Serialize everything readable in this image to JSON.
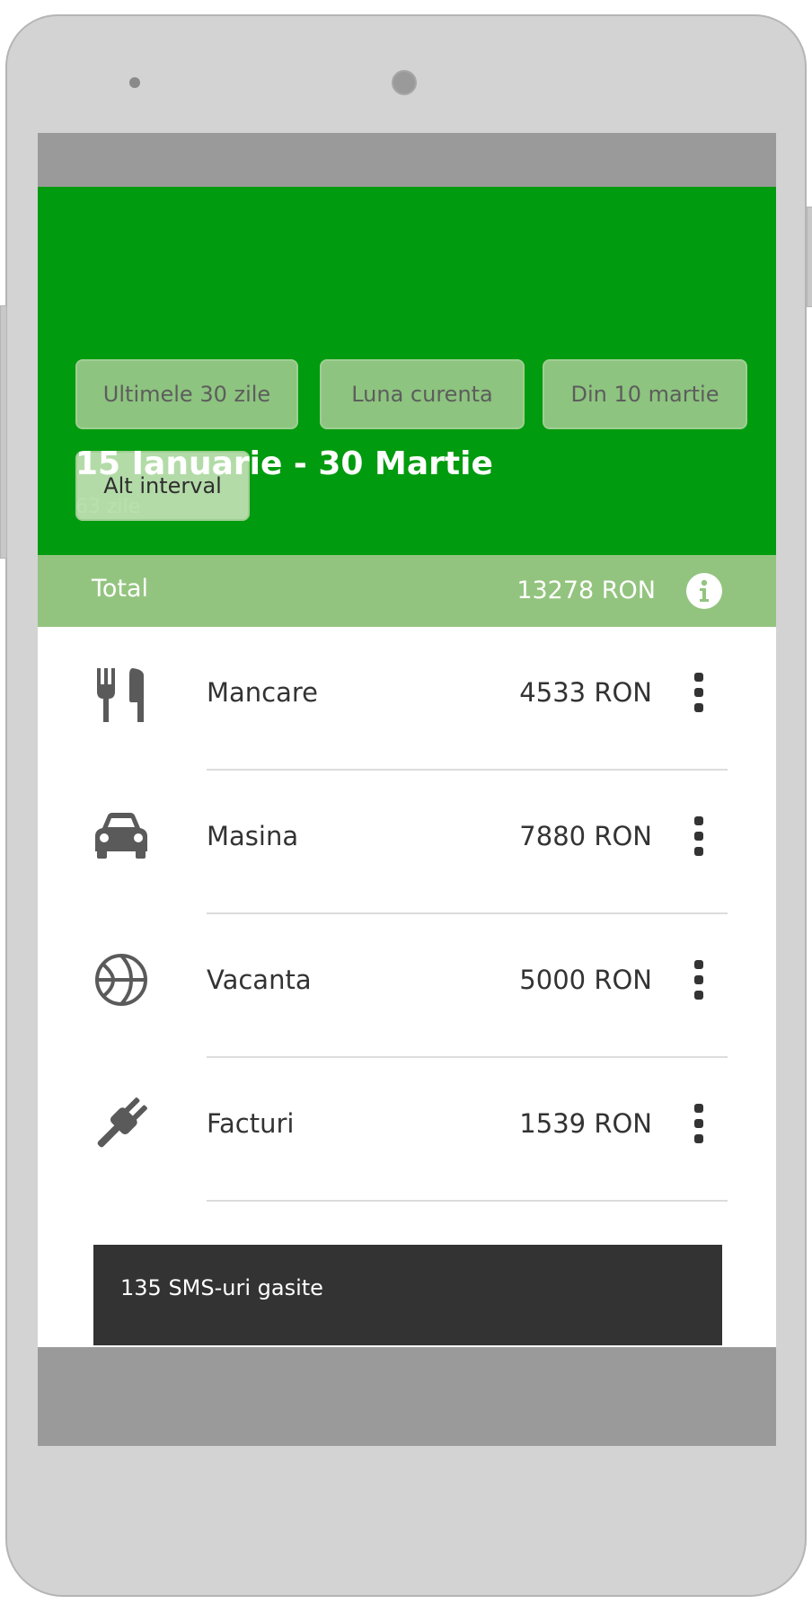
{
  "filters": [
    {
      "label": "Ultimele 30 zile",
      "active": false
    },
    {
      "label": "Luna curenta",
      "active": false
    },
    {
      "label": "Din 10 martie",
      "active": false
    },
    {
      "label": "Alt interval",
      "active": true
    }
  ],
  "range": {
    "title": "15 Ianuarie - 30 Martie",
    "days": "63 zile"
  },
  "total": {
    "label": "Total",
    "value": "13278 RON",
    "icon": "info-icon"
  },
  "categories": [
    {
      "label": "Mancare",
      "amount": "4533 RON",
      "icon": "cutlery-icon"
    },
    {
      "label": "Masina",
      "amount": "7880 RON",
      "icon": "car-icon"
    },
    {
      "label": "Vacanta",
      "amount": "5000 RON",
      "icon": "basketball-icon"
    },
    {
      "label": "Facturi",
      "amount": "1539 RON",
      "icon": "plug-icon"
    }
  ],
  "snackbar": {
    "text": "135 SMS-uri gasite"
  },
  "colors": {
    "header": "#009b0e",
    "total_bar": "#93c47f",
    "snackbar": "#333333",
    "icon": "#5a5a5a"
  }
}
